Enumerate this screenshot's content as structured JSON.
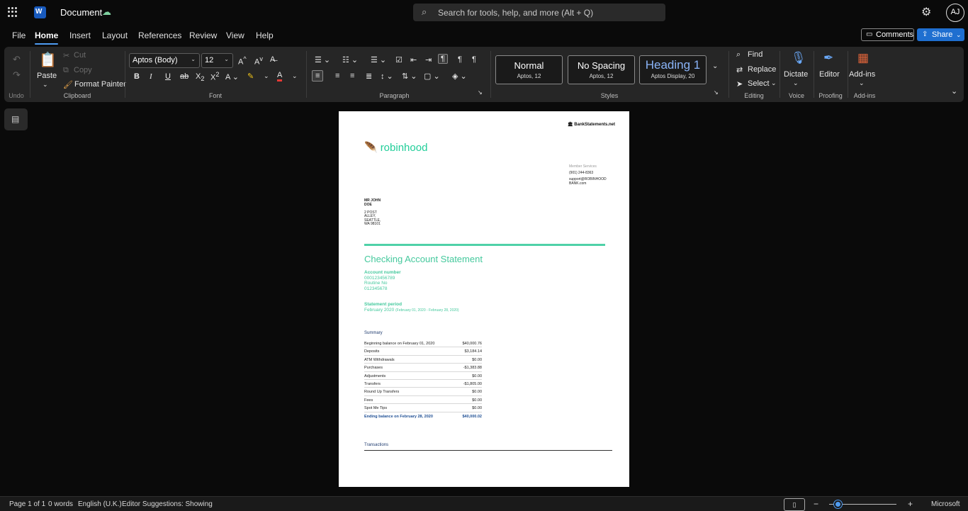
{
  "app": {
    "title": "Document",
    "search_placeholder": "Search for tools, help, and more (Alt + Q)",
    "avatar_initials": "AJ"
  },
  "menu": {
    "items": [
      "File",
      "Home",
      "Insert",
      "Layout",
      "References",
      "Review",
      "View",
      "Help"
    ],
    "active": "Home",
    "comments": "Comments",
    "share": "Share"
  },
  "ribbon": {
    "undo_group": "Undo",
    "clipboard": {
      "paste": "Paste",
      "cut": "Cut",
      "copy": "Copy",
      "format_painter": "Format Painter",
      "label": "Clipboard"
    },
    "font": {
      "name": "Aptos (Body)",
      "size": "12",
      "label": "Font"
    },
    "paragraph": {
      "label": "Paragraph"
    },
    "styles": {
      "items": [
        {
          "name": "Normal",
          "sub": "Aptos, 12"
        },
        {
          "name": "No Spacing",
          "sub": "Aptos, 12"
        },
        {
          "name": "Heading 1",
          "sub": "Aptos Display, 20"
        }
      ],
      "label": "Styles"
    },
    "editing": {
      "find": "Find",
      "replace": "Replace",
      "select": "Select",
      "label": "Editing"
    },
    "voice": {
      "dictate": "Dictate",
      "label": "Voice"
    },
    "proofing": {
      "editor": "Editor",
      "label": "Proofing"
    },
    "addins": {
      "addins": "Add-ins",
      "label": "Add-ins"
    }
  },
  "doc": {
    "bank_header": "BankStatements.net",
    "logo_text": "robinhood",
    "member_services": "Member Services",
    "phone": "(901) 244-8363",
    "email": "support@ROBINHOOD BANK.com",
    "name_line1": "MR JOHN",
    "name_line2": "DOE",
    "addr_line1": "2 POST",
    "addr_line2": "ALLEY,",
    "addr_line3": "SEATTLE,",
    "addr_line4": "WA 98101",
    "title": "Checking Account Statement",
    "account_label": "Account number",
    "account_number": "000123456789",
    "routine_label": "Routine No",
    "routine_number": "012345678",
    "period_label": "Statement period",
    "period_month": "February 2020",
    "period_range": "(February 01, 2020 - February 28, 2020)",
    "summary_label": "Summary",
    "summary": [
      {
        "label": "Beginning balance on February 01, 2020",
        "value": "$40,000.76"
      },
      {
        "label": "Deposits",
        "value": "$3,184.14"
      },
      {
        "label": "ATM Withdrawals",
        "value": "$0.00"
      },
      {
        "label": "Purchases",
        "value": "-$1,383.88"
      },
      {
        "label": "Adjustments",
        "value": "$0.00"
      },
      {
        "label": "Transfers",
        "value": "-$1,805.00"
      },
      {
        "label": "Round Up Transfers",
        "value": "$0.00"
      },
      {
        "label": "Fees",
        "value": "$0.00"
      },
      {
        "label": "Spot Me Tips",
        "value": "$0.00"
      },
      {
        "label": "Ending balance on February 28, 2020",
        "value": "$40,000.02"
      }
    ],
    "transactions_label": "Transactions"
  },
  "status": {
    "page": "Page 1 of 1",
    "words": "0 words",
    "language": "English (U.K.)",
    "editor": "Editor Suggestions: Showing",
    "zoom_minus": "−",
    "zoom_plus": "+",
    "account": "Microsoft"
  }
}
